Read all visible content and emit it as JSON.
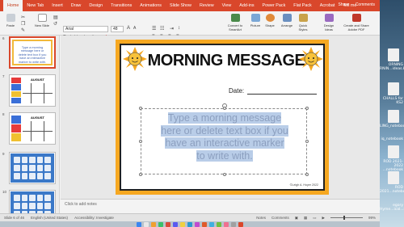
{
  "ribbon": {
    "tabs": [
      "Home",
      "Insert",
      "Draw",
      "Design",
      "Transitions",
      "Animations",
      "Slide Show",
      "Review",
      "View",
      "Add-ins",
      "Power Pack",
      "Flat Pack",
      "Acrobat"
    ],
    "new_tab": "New Tab",
    "tell_me": "Tell me",
    "share": "Share",
    "comments": "Comments"
  },
  "toolbar": {
    "paste": "Paste",
    "new_slide": "New Slide",
    "font_name": "Arial",
    "font_size": "48",
    "convert": "Convert to SmartArt",
    "picture": "Picture",
    "shape": "Shape",
    "arrange": "Arrange",
    "quick_styles": "Quick Styles",
    "design_ideas": "Design Ideas",
    "create_share": "Create and Share Adobe PDF"
  },
  "thumbnails": {
    "numbers": [
      "6",
      "7",
      "8",
      "9",
      "10"
    ],
    "slide6_text": "Type a morning message here or delete text box if you have an interactive marker to write with.",
    "month": "AUGUST"
  },
  "slide": {
    "title": "MORNING MESSAGE",
    "date_label": "Date:",
    "textbox_line1": "Type a morning message",
    "textbox_line2": "here or delete text box if you",
    "textbox_line3": "have an interactive marker",
    "textbox_line4": "to write with.",
    "copyright": "©Leigh A. Hoyer 2022"
  },
  "notes": {
    "placeholder": "Click to add notes"
  },
  "status": {
    "slide_of": "Slide 6 of 46",
    "language": "English (United States)",
    "accessibility": "Accessibility: Investigate",
    "notes_btn": "Notes",
    "comments_btn": "Comments",
    "zoom": "99%"
  },
  "desktop": {
    "labels": [
      "ORNING RNIN...ideas.key",
      "CHALLS for KS2",
      "LING_notebook",
      "iq_notebook",
      "ROD 2021-2022 ...notebook",
      "ROD 2021...notebook",
      "egory Hyme...ical...notebook"
    ]
  },
  "colors": {
    "ribbon": "#d9472b",
    "slide_frame": "#f6a821",
    "highlight": "#b9cde8",
    "text_gray": "#8c9fbf"
  }
}
